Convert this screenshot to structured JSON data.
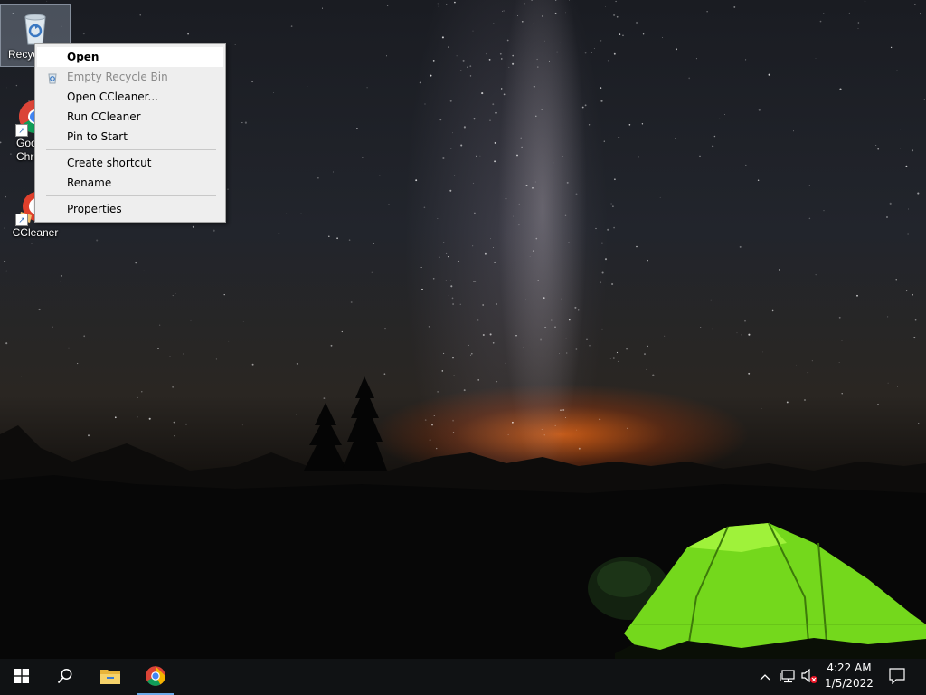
{
  "desktop": {
    "icons": [
      {
        "label": "Recycle Bin",
        "visible_label": "Recyc",
        "icon": "recycle-bin-icon",
        "selected": true
      },
      {
        "label": "Google Chrome",
        "visible_label_line1": "Goo",
        "visible_label_line2": "Chro",
        "icon": "chrome-icon"
      },
      {
        "label": "CCleaner",
        "visible_label": "CCleaner",
        "icon": "ccleaner-icon"
      }
    ]
  },
  "context_menu": {
    "items": [
      {
        "label": "Open",
        "bold": true,
        "highlighted": true
      },
      {
        "label": "Empty Recycle Bin",
        "disabled": true,
        "icon": "recycle-bin-small-icon"
      },
      {
        "label": "Open CCleaner..."
      },
      {
        "label": "Run CCleaner"
      },
      {
        "label": "Pin to Start"
      },
      {
        "label": "Create shortcut"
      },
      {
        "label": "Rename"
      },
      {
        "label": "Properties"
      }
    ]
  },
  "taskbar": {
    "start_icon": "windows-start-icon",
    "search_icon": "search-icon",
    "pinned": [
      {
        "name": "File Explorer",
        "icon": "file-explorer-icon"
      },
      {
        "name": "Google Chrome",
        "icon": "chrome-icon",
        "active": true
      }
    ],
    "tray": {
      "chevron_icon": "chevron-up-icon",
      "network_icon": "network-icon",
      "volume_icon": "volume-muted-icon",
      "notification_icon": "notification-icon"
    },
    "clock": {
      "time": "4:22 AM",
      "date": "1/5/2022"
    }
  },
  "colors": {
    "accent": "#6aa9e8",
    "taskbar": "#101214",
    "menu_bg": "#eeeeee",
    "tent_green": "#7ee81f"
  }
}
